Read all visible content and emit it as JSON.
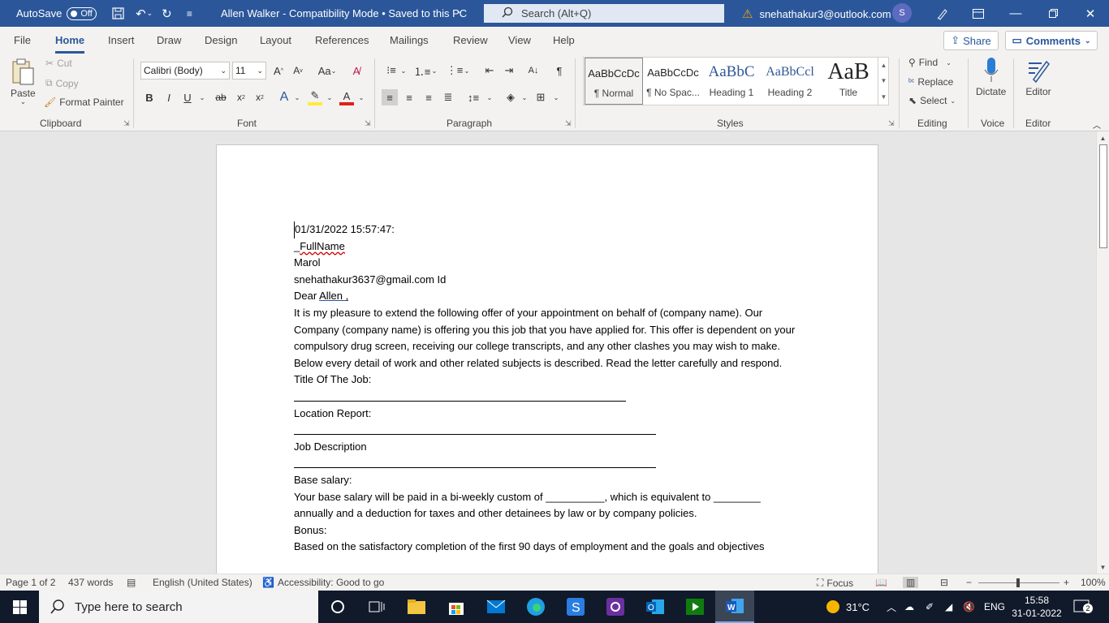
{
  "titlebar": {
    "autosave_label": "AutoSave",
    "autosave_state": "Off",
    "doc_title": "Allen Walker  -  Compatibility Mode • Saved to this PC",
    "search_placeholder": "Search (Alt+Q)",
    "account_email": "snehathakur3@outlook.com",
    "avatar_initial": "S"
  },
  "menu": {
    "tabs": [
      "File",
      "Home",
      "Insert",
      "Draw",
      "Design",
      "Layout",
      "References",
      "Mailings",
      "Review",
      "View",
      "Help"
    ],
    "active_tab": "Home",
    "share_label": "Share",
    "comments_label": "Comments"
  },
  "ribbon": {
    "clipboard": {
      "paste": "Paste",
      "cut": "Cut",
      "copy": "Copy",
      "format_painter": "Format Painter",
      "group_label": "Clipboard"
    },
    "font": {
      "font_name": "Calibri (Body)",
      "font_size": "11",
      "group_label": "Font"
    },
    "paragraph": {
      "group_label": "Paragraph"
    },
    "styles": {
      "group_label": "Styles",
      "items": [
        {
          "preview": "AaBbCcDc",
          "name": "¶ Normal"
        },
        {
          "preview": "AaBbCcDc",
          "name": "¶ No Spac..."
        },
        {
          "preview": "AaBbC",
          "name": "Heading 1"
        },
        {
          "preview": "AaBbCcl",
          "name": "Heading 2"
        },
        {
          "preview": "AaB",
          "name": "Title"
        }
      ]
    },
    "editing": {
      "find": "Find",
      "replace": "Replace",
      "select": "Select",
      "group_label": "Editing"
    },
    "voice": {
      "dictate": "Dictate",
      "group_label": "Voice"
    },
    "editor": {
      "editor": "Editor",
      "group_label": "Editor"
    }
  },
  "document": {
    "date_line": "01/31/2022 15:57:47:",
    "fullname_prefix": "_",
    "fullname_word": "FullName",
    "address": "Marol",
    "email_line": "snehathakur3637@gmail.com Id",
    "dear_prefix": "Dear ",
    "dear_name": "Allen ,",
    "para1": "It is my pleasure to extend the following offer of your appointment on behalf of (company name). Our Company (company name) is offering you this job that you have applied for. This offer is dependent on your compulsory drug screen, receiving our college transcripts, and any other clashes you may wish to make. Below every detail of work and other related subjects is described. Read the letter carefully and respond.",
    "title_of_job": "Title Of The Job:",
    "location_report": "Location Report:",
    "job_description": "Job Description",
    "base_salary": "Base salary:",
    "salary_text": "Your base salary will be paid in a bi-weekly custom of __________, which is equivalent to ________ annually and a deduction for taxes and other detainees by law or by company policies.",
    "bonus": "Bonus:",
    "bonus_text": "Based on the satisfactory completion of the first 90 days of employment and the goals and objectives"
  },
  "statusbar": {
    "page": "Page 1 of 2",
    "words": "437 words",
    "language": "English (United States)",
    "accessibility": "Accessibility: Good to go",
    "focus": "Focus",
    "zoom": "100%"
  },
  "taskbar": {
    "search_placeholder": "Type here to search",
    "weather": "31°C",
    "language": "ENG",
    "time": "15:58",
    "date": "31-01-2022",
    "notifications": "2"
  },
  "colors": {
    "word_blue": "#2b579a",
    "ribbon_bg": "#f3f2f1",
    "taskbar_bg": "#101a2b"
  }
}
